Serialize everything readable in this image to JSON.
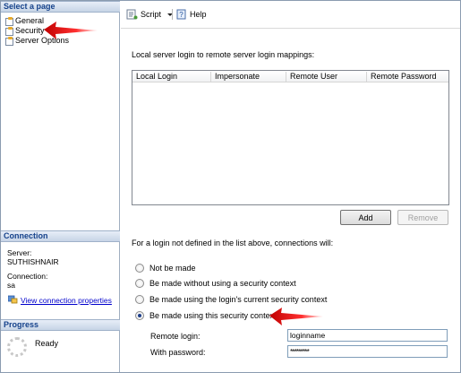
{
  "left": {
    "select_page_header": "Select a page",
    "pages": [
      {
        "label": "General"
      },
      {
        "label": "Security"
      },
      {
        "label": "Server Options"
      }
    ],
    "connection_header": "Connection",
    "server_label": "Server:",
    "server_value": "SUTHISHNAIR",
    "connection_label": "Connection:",
    "connection_value": "sa",
    "view_properties_link": "View connection properties",
    "progress_header": "Progress",
    "progress_status": "Ready"
  },
  "toolbar": {
    "script_label": "Script",
    "help_label": "Help"
  },
  "mappings": {
    "label": "Local server login to remote server login mappings:",
    "columns": [
      "Local Login",
      "Impersonate",
      "Remote User",
      "Remote Password"
    ],
    "rows": [],
    "add_label": "Add",
    "remove_label": "Remove"
  },
  "security": {
    "label": "For a login not defined in the list above, connections will:",
    "options": [
      {
        "label": "Not be made",
        "checked": false
      },
      {
        "label": "Be made without using a security context",
        "checked": false
      },
      {
        "label": "Be made using the login's current security context",
        "checked": false
      },
      {
        "label": "Be made using this security context:",
        "checked": true
      }
    ],
    "remote_login_label": "Remote login:",
    "remote_login_value": "loginname",
    "password_label": "With password:",
    "password_value": "*********"
  },
  "colors": {
    "header_gradient_top": "#e7eef8",
    "header_gradient_bottom": "#c6d4e6",
    "link": "#0000cc",
    "annotation_arrow": "#e02020"
  }
}
